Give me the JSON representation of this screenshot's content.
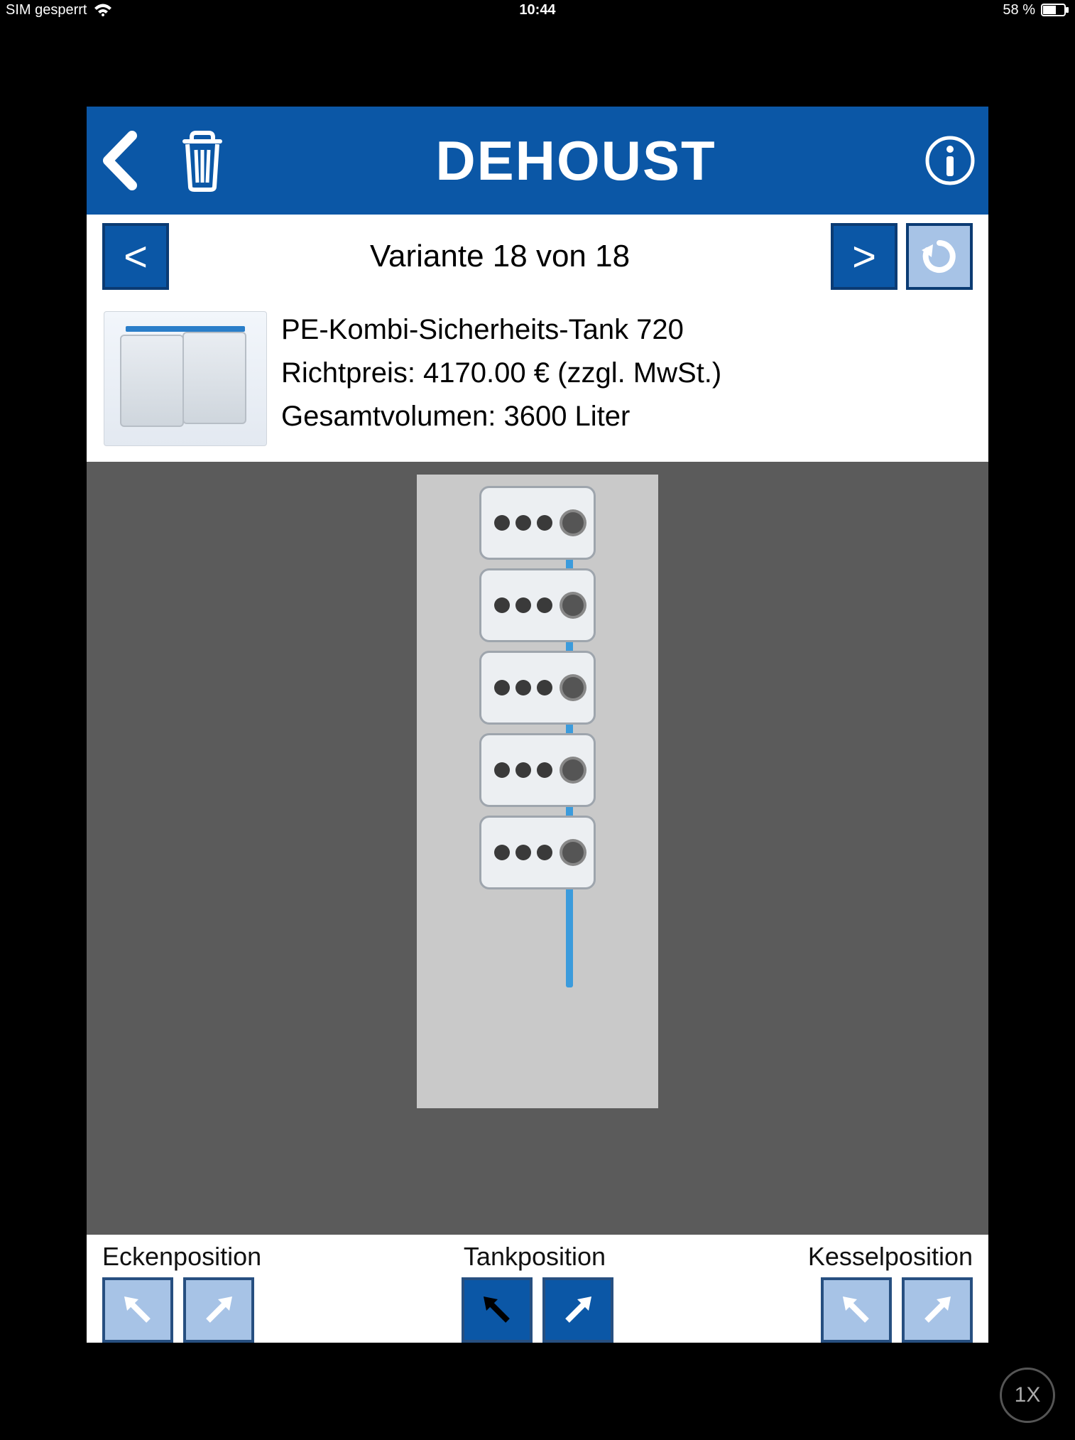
{
  "status": {
    "sim": "SIM gesperrt",
    "time": "10:44",
    "battery_pct": "58 %"
  },
  "header": {
    "brand": "DEHOUST"
  },
  "variant": {
    "label": "Variante 18 von 18"
  },
  "product": {
    "name": "PE-Kombi-Sicherheits-Tank 720",
    "price_line": "Richtpreis: 4170.00 € (zzgl. MwSt.)",
    "volume_line": "Gesamtvolumen: 3600 Liter"
  },
  "layout": {
    "tank_count": 5
  },
  "footer": {
    "ecken": "Eckenposition",
    "tank": "Tankposition",
    "kessel": "Kesselposition"
  },
  "zoom": "1X"
}
